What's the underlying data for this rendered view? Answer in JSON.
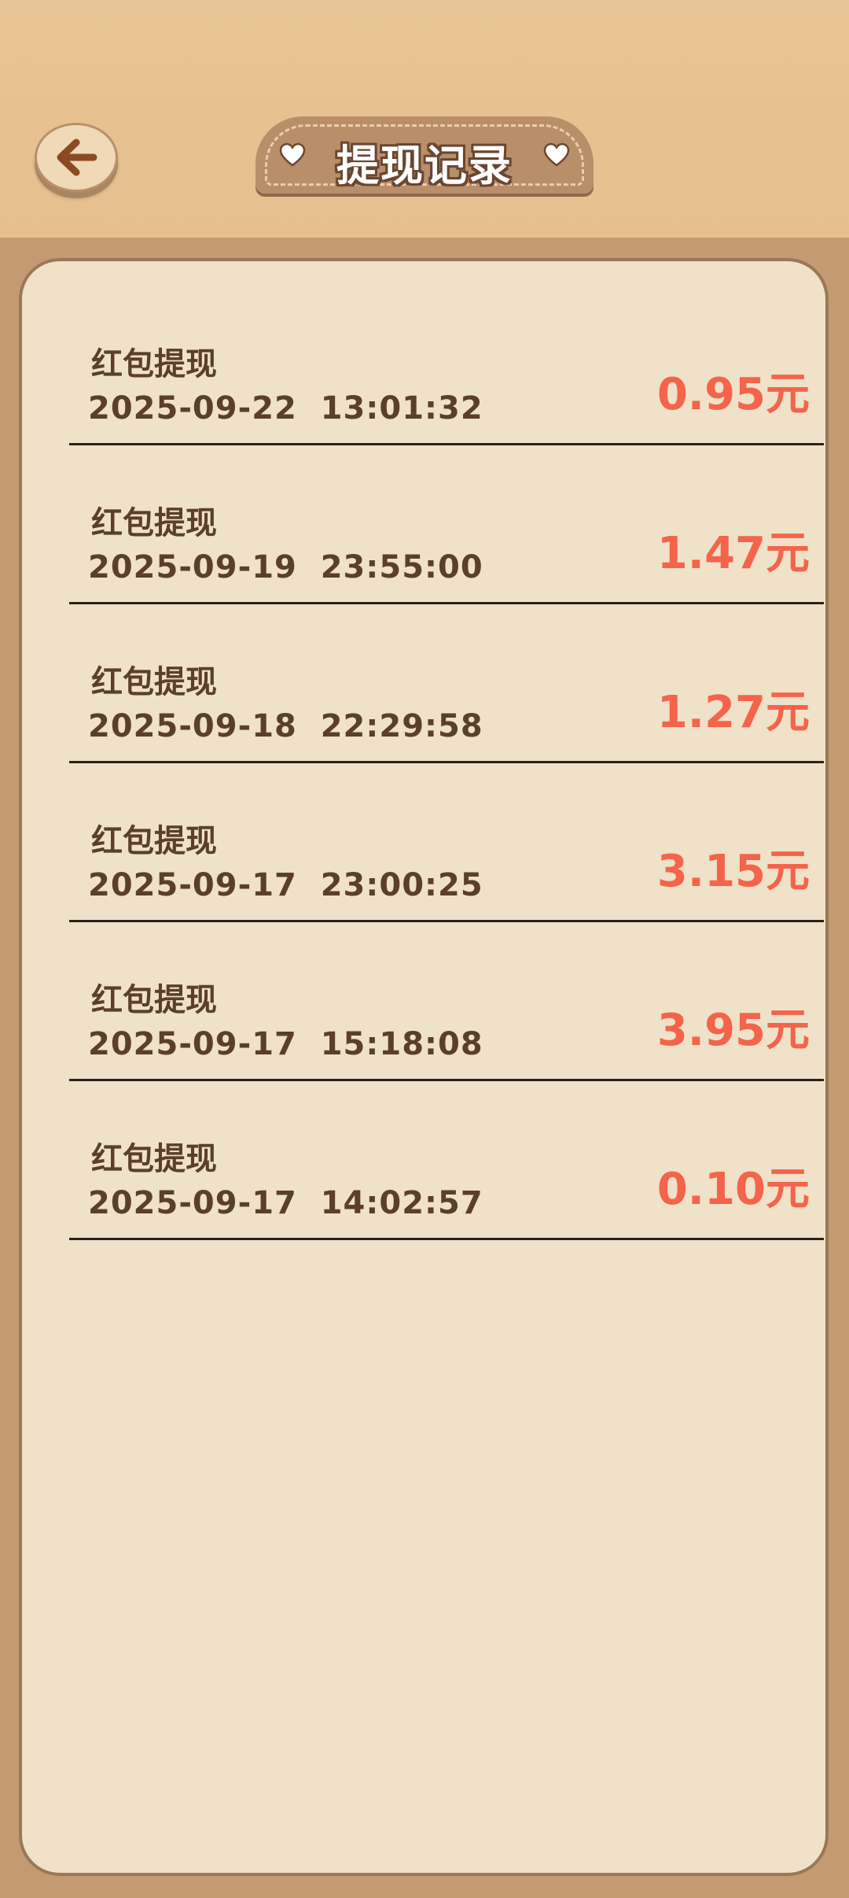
{
  "header": {
    "title": "提现记录"
  },
  "colors": {
    "header_bg": "#e8c594",
    "frame_bg": "#c49a72",
    "card_bg": "#f0e1c9",
    "text": "#5a3f2c",
    "amount": "#f4644a"
  },
  "records": [
    {
      "title": "红包提现",
      "time": "2025-09-22  13:01:32",
      "amount": "0.95元"
    },
    {
      "title": "红包提现",
      "time": "2025-09-19  23:55:00",
      "amount": "1.47元"
    },
    {
      "title": "红包提现",
      "time": "2025-09-18  22:29:58",
      "amount": "1.27元"
    },
    {
      "title": "红包提现",
      "time": "2025-09-17  23:00:25",
      "amount": "3.15元"
    },
    {
      "title": "红包提现",
      "time": "2025-09-17  15:18:08",
      "amount": "3.95元"
    },
    {
      "title": "红包提现",
      "time": "2025-09-17  14:02:57",
      "amount": "0.10元"
    }
  ]
}
